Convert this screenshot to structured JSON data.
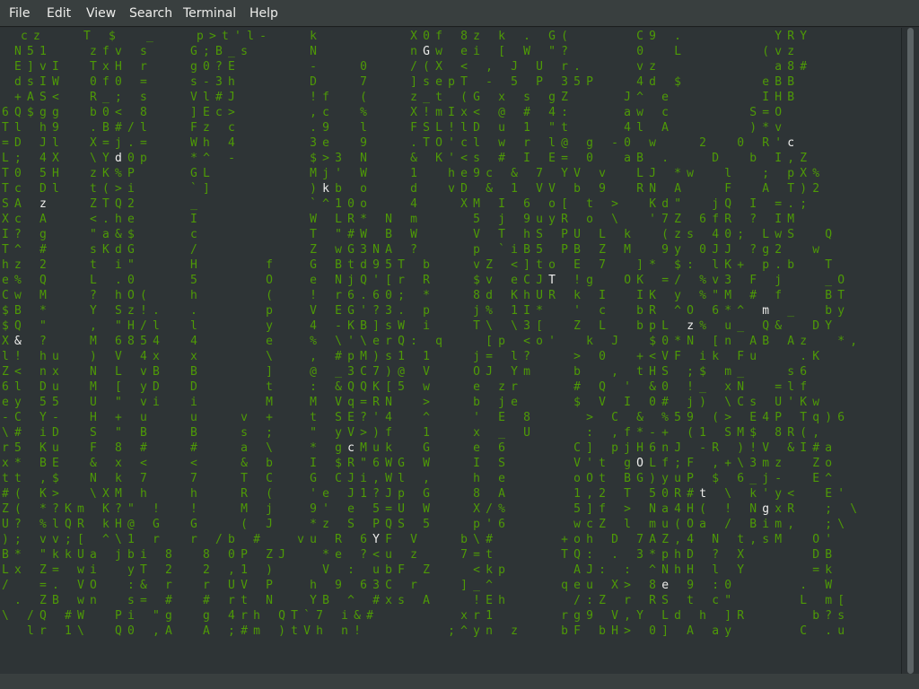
{
  "menu": {
    "file": "File",
    "edit": "Edit",
    "view": "View",
    "search": "Search",
    "terminal": "Terminal",
    "help": "Help"
  },
  "colors": {
    "rain": "#4e9a06",
    "bright": "#eeeeec",
    "background": "#2e3436",
    "menubar": "#393f3f"
  },
  "terminal": {
    "lines": [
      "   c z       T   $     _       p > t ' l -       k               X 0 f   8 z   k   .   G (           C 9   .               Y R Y",
      "  N 5 1       z f v   s       G ; B _ s          N               n G w   e i   [   W   \" ?           0     L             ( v z",
      "  E ] v I     T x H   r       g 0 ? E            -       0       / ( X   <   ,   J   U   r .         v z                   a 8 #",
      "  d s I W     0 f 0   =       s - 3 h            D       7       ] s e p T   -   5   P   3 5 P       4 d   $             e B B",
      "  + A S <     R _ ;   s       V l # J            ! f     (       z _ t   ( G   x   s   g Z         J ^   e               I H B",
      "6 Q $ g g     b 0 <   8       ] E c >            , c     %       X ! m I x <   @   #   4 :         a w   c             S = O",
      "T l   h 9     . B # / l       F z   c            . 9     l       F S L ! l D   u   1   \" t         4 l   A             ) * v",
      "= D   J l     X = j . =       W h   4            3 e     9       . T O ' c l   w   r   l @   g   - 0   w       2     0   R ' c",
      "L ;   4 X     \\ Y d 0 p       * ^   -            $ > 3   N       &   K ' < s   #   I   E =   0     a B   .       D     b   I , Z",
      "T 0   5 H     z K % P         G L                M j '   W       1     h e 9 c   &   7   Y V   v     L J   * w     l     ;   p X %",
      "T c   D l     t ( > i         ` ]                ) k b   o       d     v D   &   1   V V   b   9     R N   A       F     A   T ) 2",
      "S A   z       Z T Q 2         _                  ` ^ 1 0 o       4       X M   I   6   o [   t   >     K d \"     j Q   I   = . ;",
      "X c   A       < . h e         I                  W   L R *   N   m         5   j   9 u y R   o   \\     ' 7 Z   6 f R   ?   I M",
      "I ?   g       \" a & $         c                  T   \" # W   B   W         V   T   h S   P U   L   k     ( z s   4 0 ;   L w S     Q",
      "T ^   #       s K d G         /                  Z   w G 3 N A   ?         p   ` i B 5   P B   Z   M     9 y   0 J J   ? g 2     w",
      "h z   2       t   i \"         H           f      G   B t d 9 5 T   b       v Z   < ] t o   E   7     ] *   $ :   l K +   p . b     T",
      "e %   Q       L   . 0         5           O      e   N j Q ' [ r   R       $ v   e C J T   ! g     O K   = /   % v 3   F   j       _ O",
      "C w   M       ?   h O (       h           (      !   r 6 . 6 0 ;   *       8 d   K h U R   k   I     I K   y   % \" M   #   f       B T",
      "$ B   *       Y   S z ! .     .           p      V   E G ' ? 3 .   p       j %   1 I *     '   c     b R   ^ O   6 * ^   m   _     b y",
      "$ Q   \"       ,   \" H / l     l           y      4   - K B ] s W   i       T \\   \\ 3 [     Z   L     b p L   z %   u _   Q &     D Y",
      "X &   ?       M   6 8 5 4     4           e      %   \\ ' \\ e r Q :   q       [ p   < o '     k   J     $ 0 * N   [ n   A B   A z     * ,",
      "l !   h u     )   V   4 x     x           \\      ,   # p M ) s 1   1       j =   l ?       >   0     + < V F   i k   F u       . K",
      "Z <   n x     N   L   v B     B           ]      @   _ 3 C 7 ) @   V       O J   Y m       b     ,   t H S   ; $   m _       s 6",
      "6 l   D u     M   [   y D     D           t      :   & Q Q K [ 5   w       e   z r         #   Q   '   & 0   ! _   x N     = l f",
      "e y   5 5     U   \"   v i     i           M      M   V q = R N     >       b   j e         $   V   I   0 #   j )   \\ C s   U ' K w",
      "- C   Y -     H   +   u       u       v   +      t   S E ? ' 4     ^       '   E   8         >   C   &   % 5 9   ( >   E 4 P   T q ) 6",
      "\\ #   i D     S   \"   B       B       s   ;      \"   y V > ) f     1       x   _   U         :   , f * - +   ( 1   S M $   8 R ( ,",
      "r 5   K u     F   8   #       #       a   \\      *   g c M u k     G       e   6           C ]   p j H 6 n J   - R   ) ! V   & I # a",
      "x *   B E     &   x   <       <       &   b      I   $ R \" 6 W G   W       I   S           V ' t   g O L f ; F   , + \\ 3 m z     Z o",
      "t t   , $     N   k   7       7       T   C      G   C J i , W l   ,       h   e           o O t   B G ) y u P   $   6 _ j -     E ^",
      "# (   K >     \\ X M   h       h       R   (      ' e   J 1 ? J p   G       8   A           1 , 2   T   5 0 R # t   \\   k ' y <     E '",
      "Z (   * ? K m   K ? \"   !     !       M   j      9 '   e   5 = U   W       X / %           5 ] f   >   N a 4 H (   !   N g x R     ;   \\",
      "U ?   % l Q R   k H @   G     G       (   J      * z   S   P Q S   5       p ' 6           w c Z   l   m u ( O a   /   B i m ,     ; \\",
      ") ;   v v ; [   ^ \\ 1   r     r   / b   #      v u   R   6 Y F   V       b \\ #           + o h   D   7 A Z , 4   N   t , s M     O '",
      "B *   \" k k U a   j b i   8     8   0 P   Z J      * e   ? < u   z       7 = t           T Q :   .   3 * p h D   ?   X           D B",
      "L x   Z =   w i     y T   2     2   , 1   )        V   :   u b F   Z       < k p           A J :   :   ^ N h H   l   Y           = k",
      "/     = .   V O     : &   r     r   U V   P      h   9   6 3 C   r       ] _ ^           q e u   X >   8 e   9   : 0           .   W",
      "  .   Z B   w n     s =   #     #   r t   N      Y B   ^   # x s   A       ! E h           / : Z   r   R S   t   c \"           L   m [",
      "\\   / Q   # W     P i   \" g     g   4 r h   Q T ` 7   i & #              x r 1           r g 9   V , Y   L d   h   ] R           b ? s",
      "    l r   1 \\     Q 0   , A     A   ; # m   ) t V h   n !              ; ^ y n   z       b F   b H >   0 ]   A   a y           C   . u"
    ]
  }
}
